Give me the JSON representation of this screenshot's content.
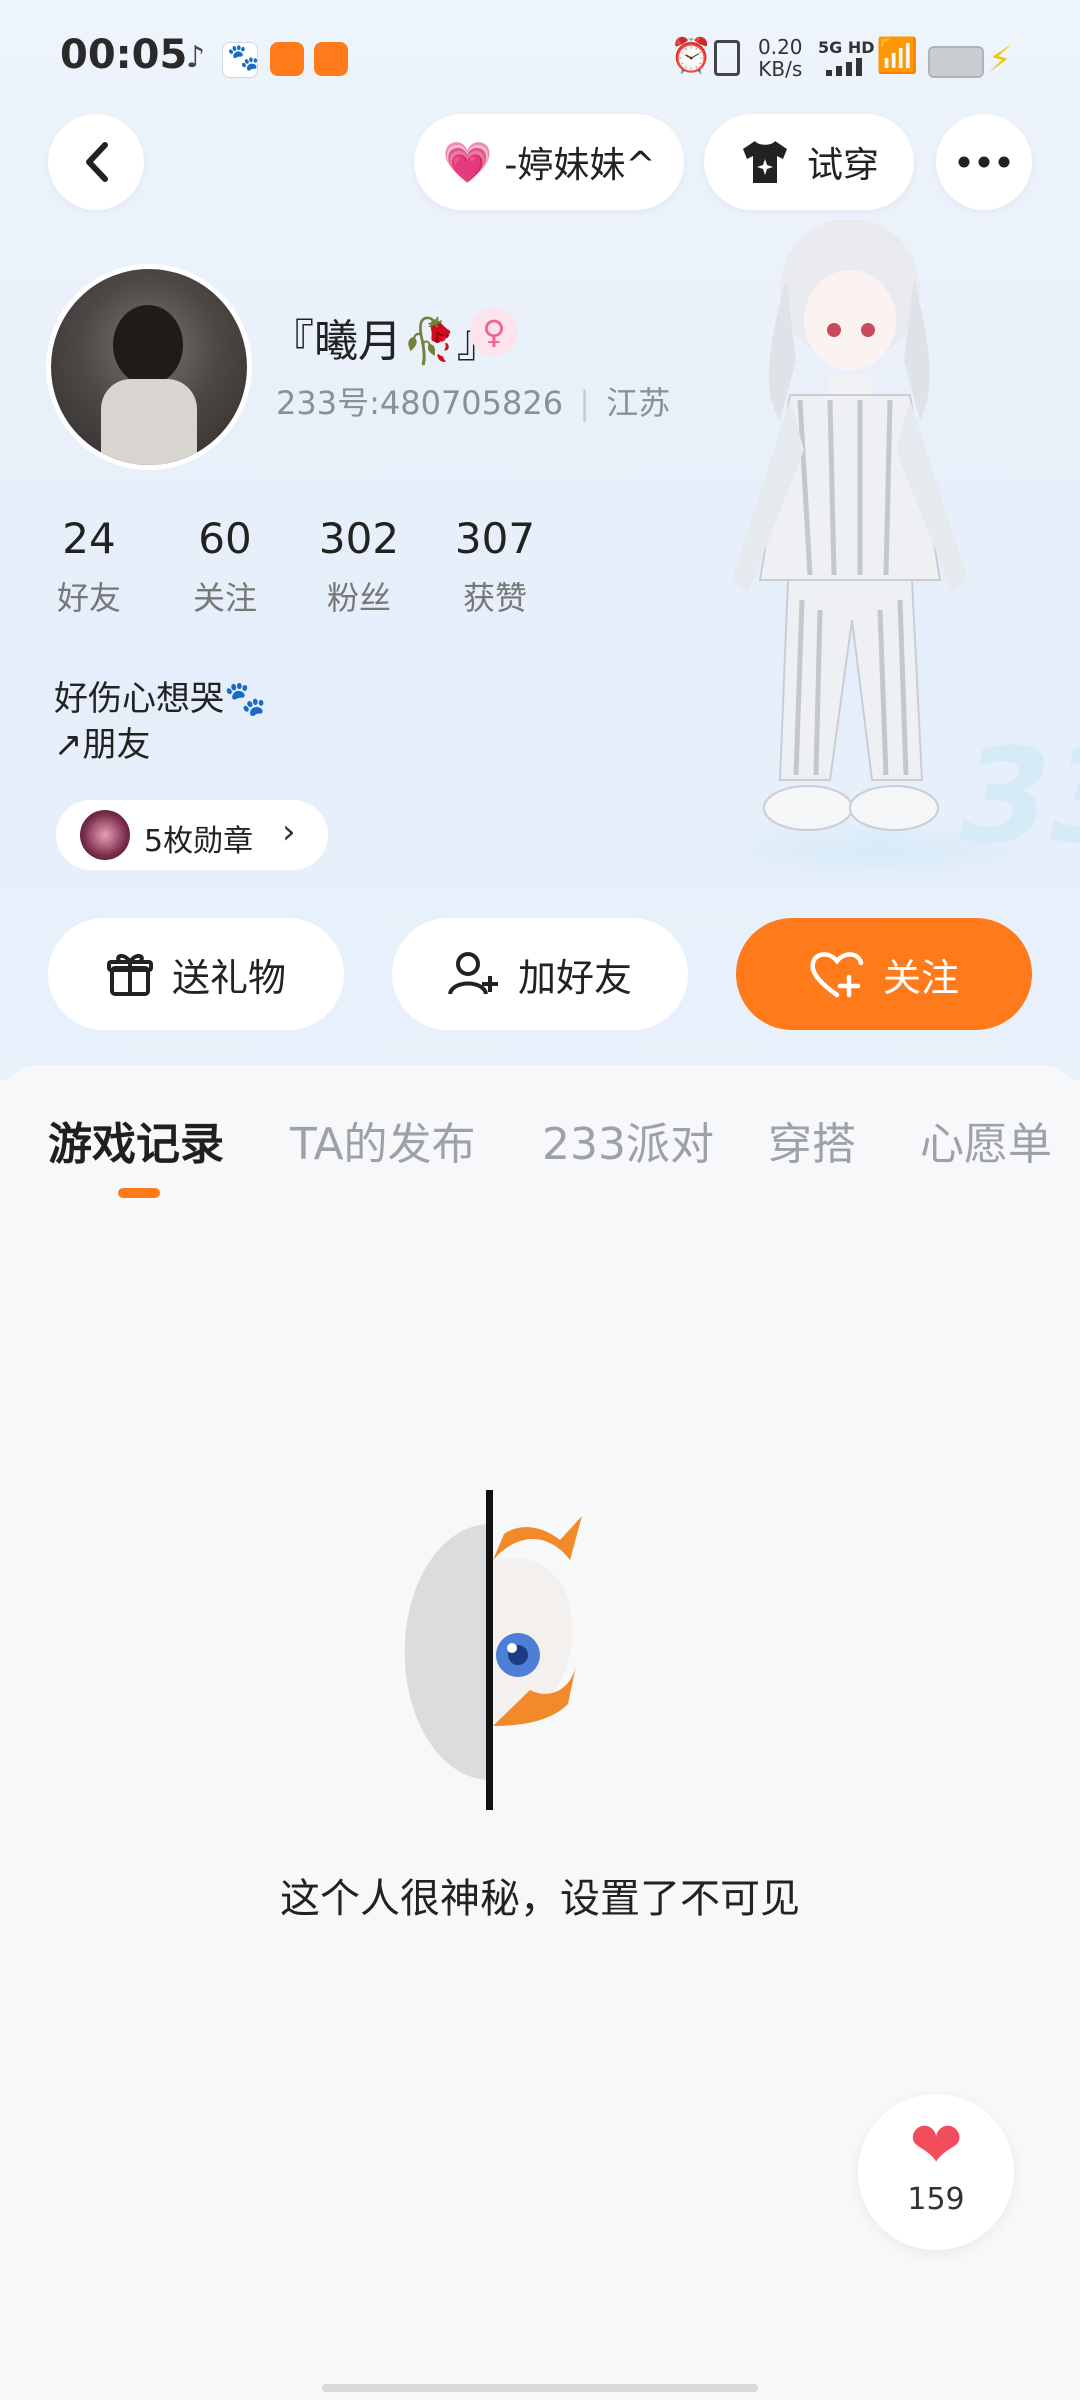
{
  "status_bar": {
    "time": "00:05",
    "net_speed": "0.20",
    "net_unit": "KB/s",
    "network": "5G HD"
  },
  "top_nav": {
    "back_icon": "back-chevron-icon",
    "relation_label": "-婷妹妹^",
    "try_on_label": "试穿",
    "more_icon": "more-dots-icon"
  },
  "profile": {
    "name": "『曦月🥀』",
    "gender_icon": "female-icon",
    "uid": "233号:480705826",
    "location": "江苏",
    "stats": [
      {
        "num": "24",
        "label": "好友"
      },
      {
        "num": "60",
        "label": "关注"
      },
      {
        "num": "302",
        "label": "粉丝"
      },
      {
        "num": "307",
        "label": "获赞"
      }
    ],
    "bio_line1": "好伤心想哭🐾",
    "bio_line2": "↗朋友",
    "badges_label": "5枚勋章"
  },
  "actions": {
    "gift": "送礼物",
    "add_friend": "加好友",
    "follow": "关注"
  },
  "tabs": [
    "游戏记录",
    "TA的发布",
    "233派对",
    "穿搭",
    "心愿单"
  ],
  "empty_state": {
    "message": "这个人很神秘，设置了不可见"
  },
  "like": {
    "count": "159"
  },
  "colors": {
    "accent": "#ff7a1a",
    "heart": "#f24d5d",
    "pink": "#f06292"
  }
}
